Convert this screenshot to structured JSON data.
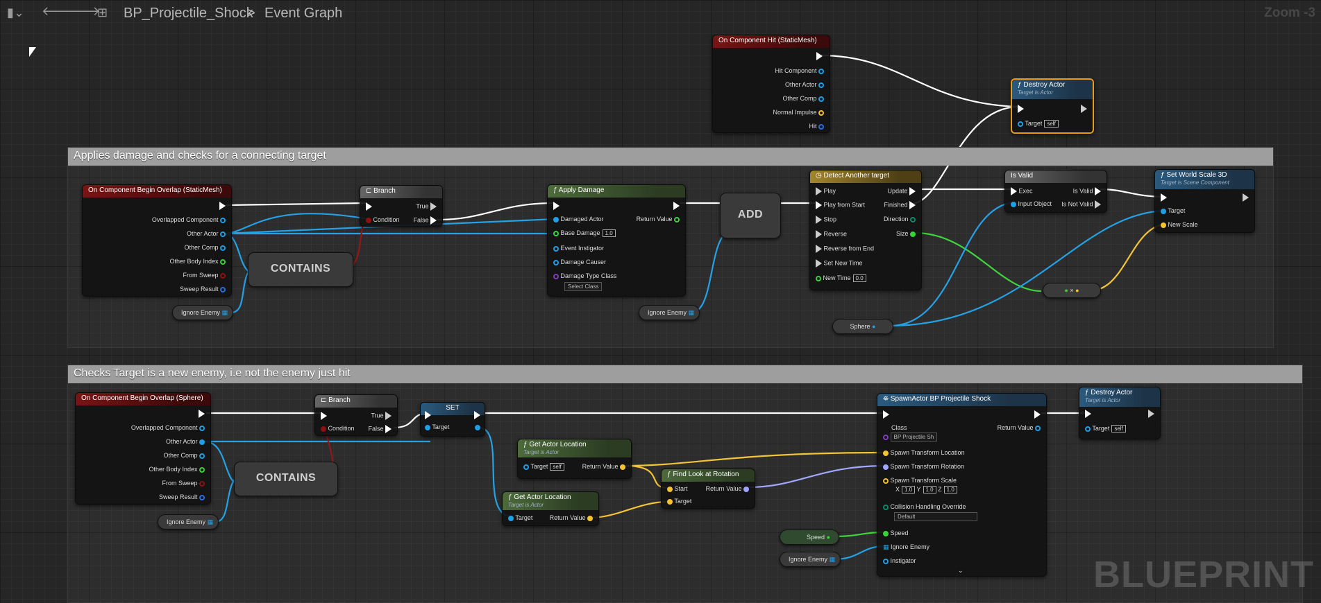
{
  "toolbar": {
    "bookmark_icon": "bookmark-icon",
    "back_icon": "arrow-left-icon",
    "forward_icon": "arrow-right-icon",
    "graph_icon": "graph-icon",
    "blueprint_name": "BP_Projectile_Shock",
    "separator": ">",
    "graph_name": "Event Graph",
    "zoom": "Zoom -3"
  },
  "colors": {
    "exec": "#ffffff",
    "object": "#1e9fe6",
    "vector": "#f4c230",
    "float": "#39d239",
    "bool": "#8f1010",
    "struct": "#2d6be0",
    "rotator": "#9fa5ff",
    "selection": "#e89b18"
  },
  "comments": {
    "top": "Applies damage and checks for a connecting target",
    "bottom": "Checks Target is a new enemy, i.e not the enemy just hit"
  },
  "nodes": {
    "hit": {
      "title": "On Component Hit (StaticMesh)",
      "pins": [
        "Hit Component",
        "Other Actor",
        "Other Comp",
        "Normal Impulse",
        "Hit"
      ]
    },
    "destroy1": {
      "title": "Destroy Actor",
      "sub": "Target is Actor",
      "target": "Target",
      "target_value": "self"
    },
    "overlap1": {
      "title": "On Component Begin Overlap (StaticMesh)",
      "pins": [
        "Overlapped Component",
        "Other Actor",
        "Other Comp",
        "Other Body Index",
        "From Sweep",
        "Sweep Result"
      ]
    },
    "branch1": {
      "title": "Branch",
      "true": "True",
      "false": "False",
      "condition": "Condition"
    },
    "contains1": {
      "label": "CONTAINS"
    },
    "ignore1": {
      "label": "Ignore Enemy"
    },
    "apply_damage": {
      "title": "Apply Damage",
      "pins": [
        "Damaged Actor",
        "Base Damage",
        "Event Instigator",
        "Damage Causer",
        "Damage Type Class"
      ],
      "base_damage_value": "1.0",
      "class_select": "Select Class",
      "return": "Return Value"
    },
    "add": {
      "label": "ADD"
    },
    "ignore2": {
      "label": "Ignore Enemy"
    },
    "timeline": {
      "title": "Detect Another target",
      "inputs": [
        "Play",
        "Play from Start",
        "Stop",
        "Reverse",
        "Reverse from End",
        "Set New Time",
        "New Time"
      ],
      "new_time_value": "0.0",
      "outputs": [
        "Update",
        "Finished",
        "Direction",
        "Size"
      ]
    },
    "isvalid": {
      "title": "Is Valid",
      "exec": "Exec",
      "input": "Input Object",
      "valid": "Is Valid",
      "not_valid": "Is Not Valid"
    },
    "setscale": {
      "title": "Set World Scale 3D",
      "sub": "Target is Scene Component",
      "target": "Target",
      "new_scale": "New Scale"
    },
    "mult": {
      "label": "×"
    },
    "sphere": {
      "label": "Sphere"
    },
    "overlap2": {
      "title": "On Component Begin Overlap (Sphere)",
      "pins": [
        "Overlapped Component",
        "Other Actor",
        "Other Comp",
        "Other Body Index",
        "From Sweep",
        "Sweep Result"
      ]
    },
    "branch2": {
      "title": "Branch",
      "true": "True",
      "false": "False",
      "condition": "Condition"
    },
    "contains2": {
      "label": "CONTAINS"
    },
    "ignore3": {
      "label": "Ignore Enemy"
    },
    "set": {
      "title": "SET",
      "target": "Target"
    },
    "gal1": {
      "title": "Get Actor Location",
      "sub": "Target is Actor",
      "target": "Target",
      "target_value": "self",
      "return": "Return Value"
    },
    "gal2": {
      "title": "Get Actor Location",
      "sub": "Target is Actor",
      "target": "Target",
      "return": "Return Value"
    },
    "findlook": {
      "title": "Find Look at Rotation",
      "start": "Start",
      "target": "Target",
      "return": "Return Value"
    },
    "spawn": {
      "title": "SpawnActor BP Projectile Shock",
      "class_label": "Class",
      "class_value": "BP Projectile Sh",
      "return": "Return Value",
      "pins": [
        "Spawn Transform Location",
        "Spawn Transform Rotation",
        "Spawn Transform Scale"
      ],
      "scale_x_label": "X",
      "scale_x": "1.0",
      "scale_y_label": "Y",
      "scale_y": "1.0",
      "scale_z_label": "Z",
      "scale_z": "1.0",
      "collision_label": "Collision Handling Override",
      "collision_value": "Default",
      "speed": "Speed",
      "ignore": "Ignore Enemy",
      "instigator": "Instigator"
    },
    "destroy2": {
      "title": "Destroy Actor",
      "sub": "Target is Actor",
      "target": "Target",
      "target_value": "self"
    },
    "speed_var": {
      "label": "Speed"
    },
    "ignore4": {
      "label": "Ignore Enemy"
    }
  },
  "watermark": "BLUEPRINT"
}
